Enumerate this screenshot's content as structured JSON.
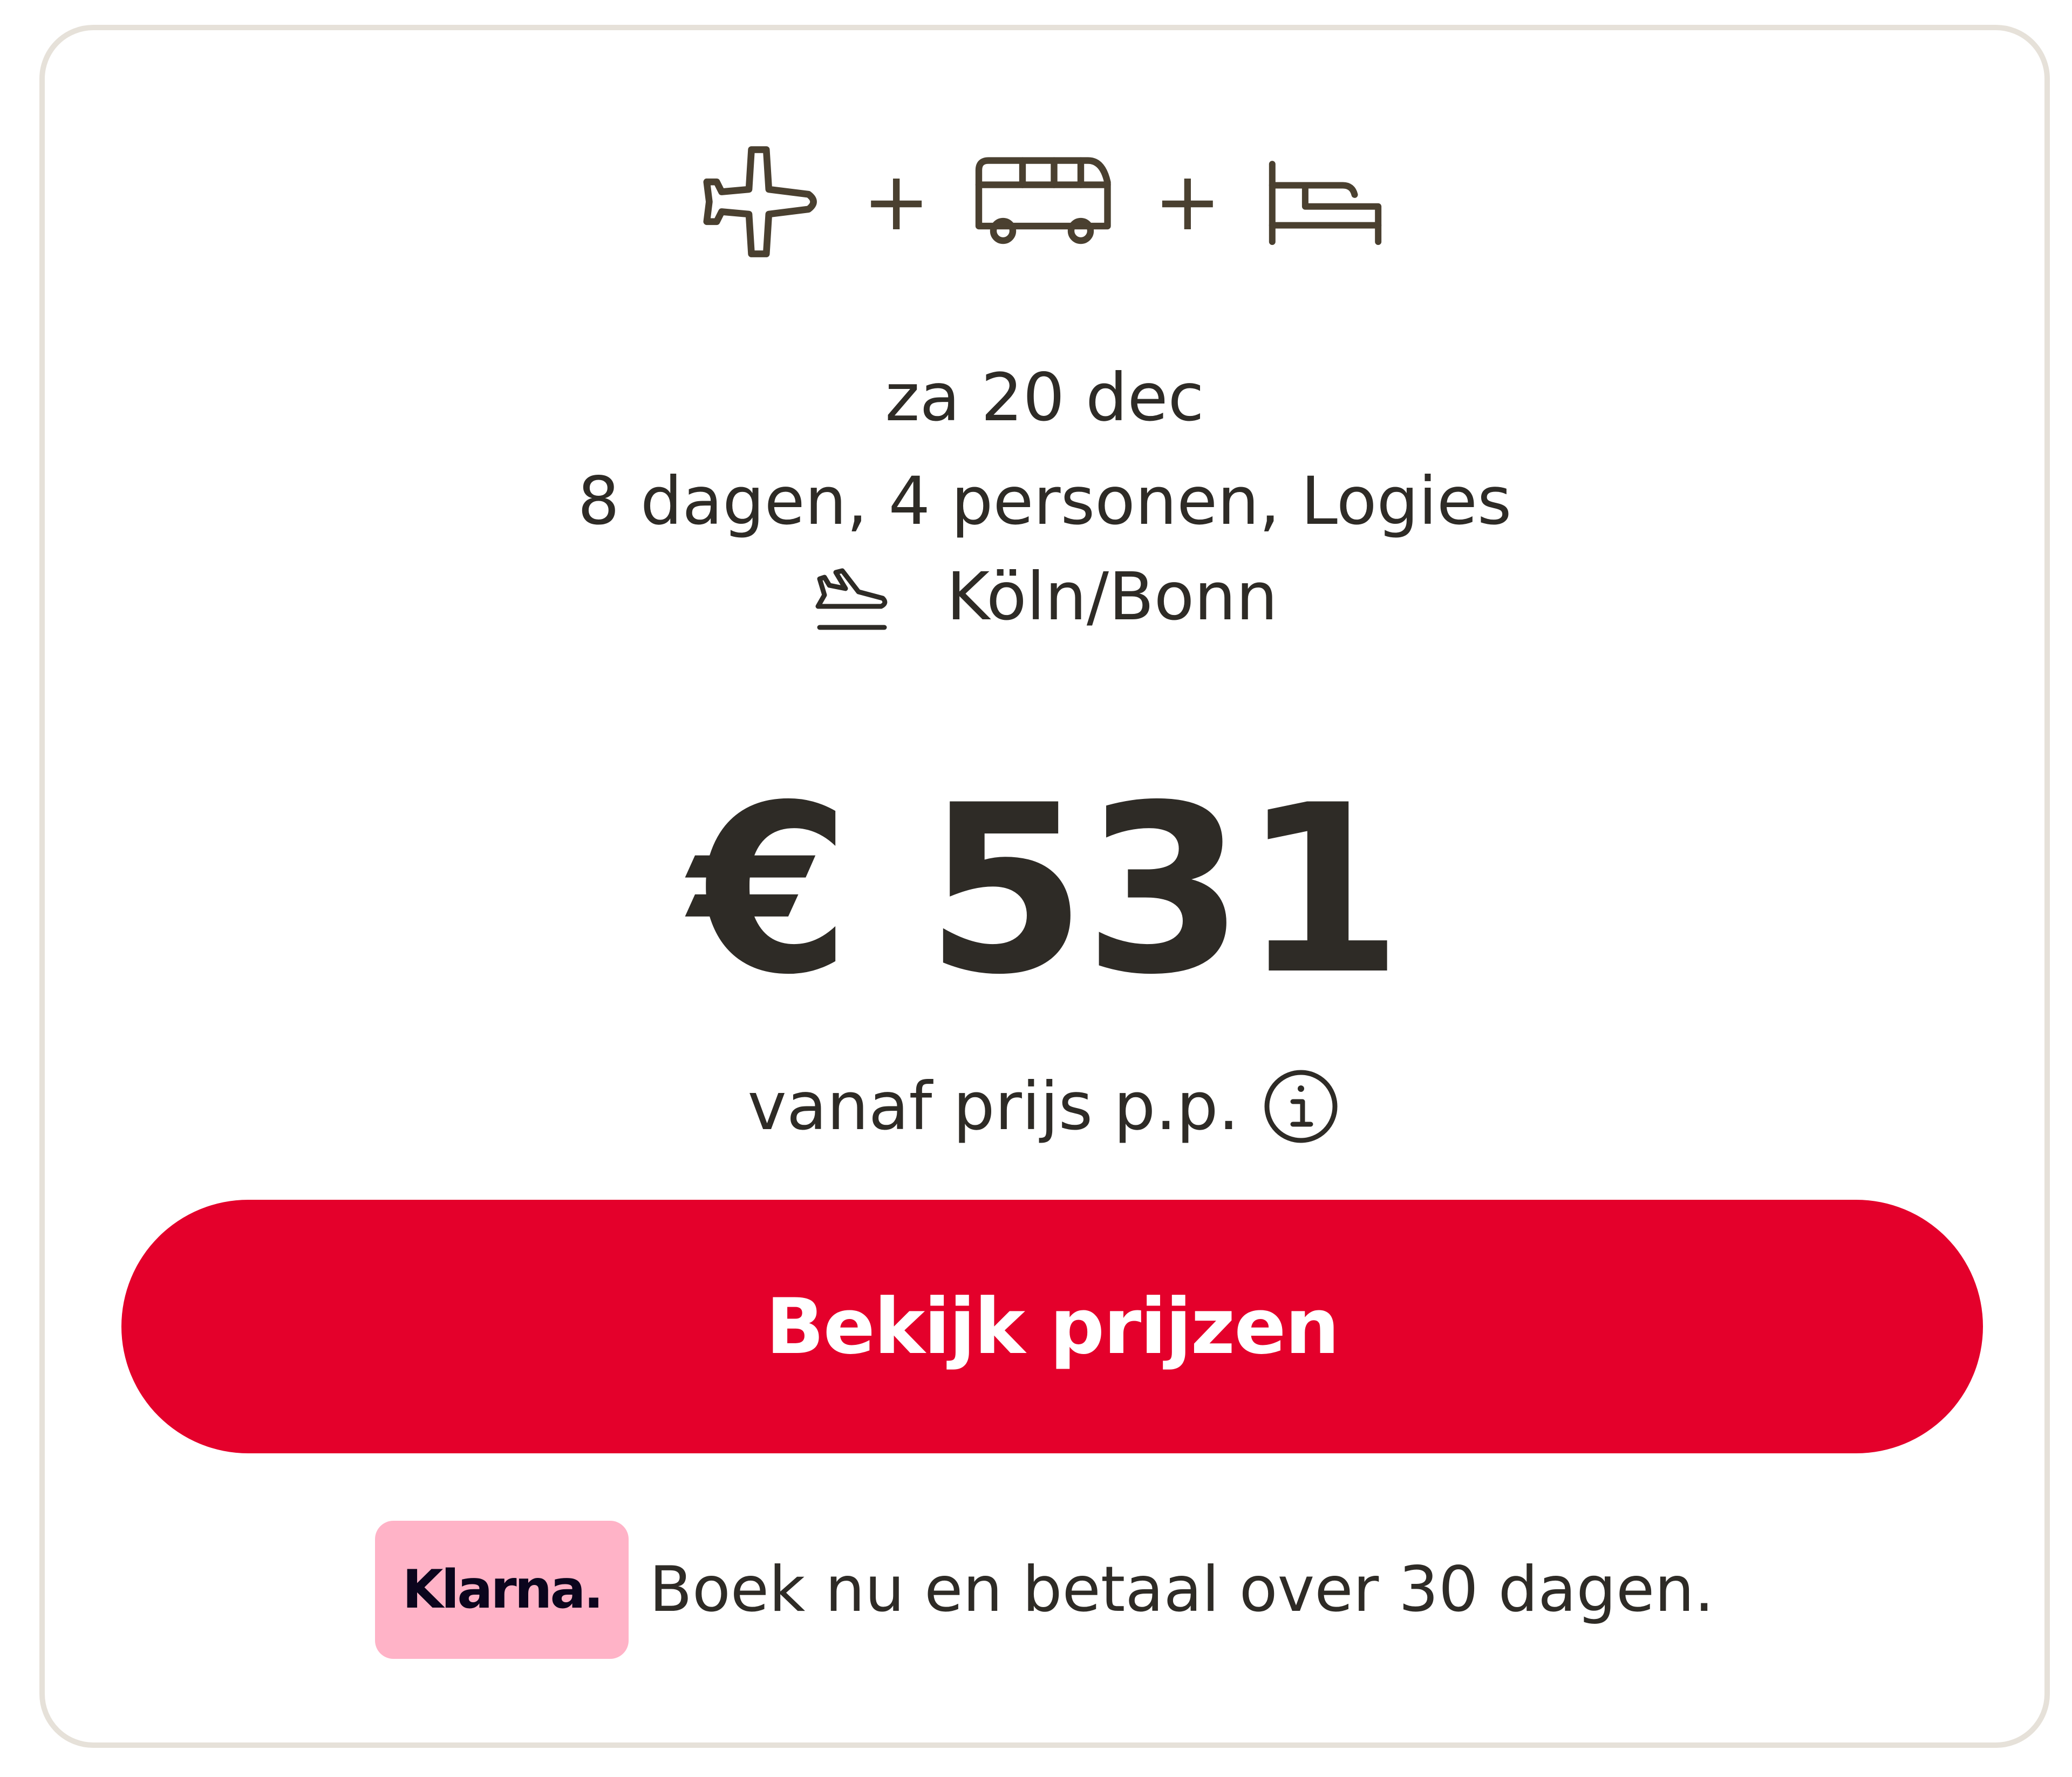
{
  "package": {
    "icons": [
      "airplane-icon",
      "bus-icon",
      "bed-icon"
    ],
    "separator": "+"
  },
  "details": {
    "date": "za 20 dec",
    "trip": "8 dagen, 4 personen, Logies",
    "departure_airport": "Köln/Bonn"
  },
  "price": {
    "amount": "€ 531",
    "label": "vanaf prijs p.p."
  },
  "cta": {
    "label": "Bekijk prijzen"
  },
  "klarna": {
    "logo_text": "Klarna.",
    "message": "Boek nu en betaal over 30 dagen."
  },
  "colors": {
    "accent": "#e4002b",
    "text": "#2e2b26",
    "icon": "#4a4030",
    "border": "#e6e1d9",
    "klarna_pink": "#ffb3c7"
  }
}
